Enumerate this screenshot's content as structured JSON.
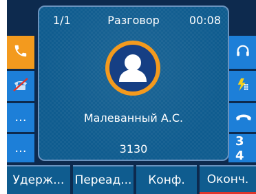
{
  "call": {
    "count": "1/1",
    "state": "Разговор",
    "timer": "00:08",
    "contact_name": "Малеванный А.С.",
    "contact_number": "3130",
    "avatar_icon": "person-icon"
  },
  "left_rail": [
    {
      "icon": "phone-handset-icon",
      "active": true
    },
    {
      "icon": "phone-muted-icon",
      "active": false
    },
    {
      "label": "...",
      "active": false
    },
    {
      "label": "...",
      "active": false
    }
  ],
  "right_rail": [
    {
      "icon": "headset-icon"
    },
    {
      "icon": "dnd-icon"
    },
    {
      "icon": "phone-hangup-icon"
    },
    {
      "label": "3 4"
    }
  ],
  "softkeys": [
    "Удерж...",
    "Переад...",
    "Конф.",
    "Оконч."
  ],
  "colors": {
    "background": "#0d2a4e",
    "panel": "#0f5c8f",
    "rail": "#1d7fd8",
    "accent": "#f39a1e",
    "end_call": "#e0352b"
  }
}
